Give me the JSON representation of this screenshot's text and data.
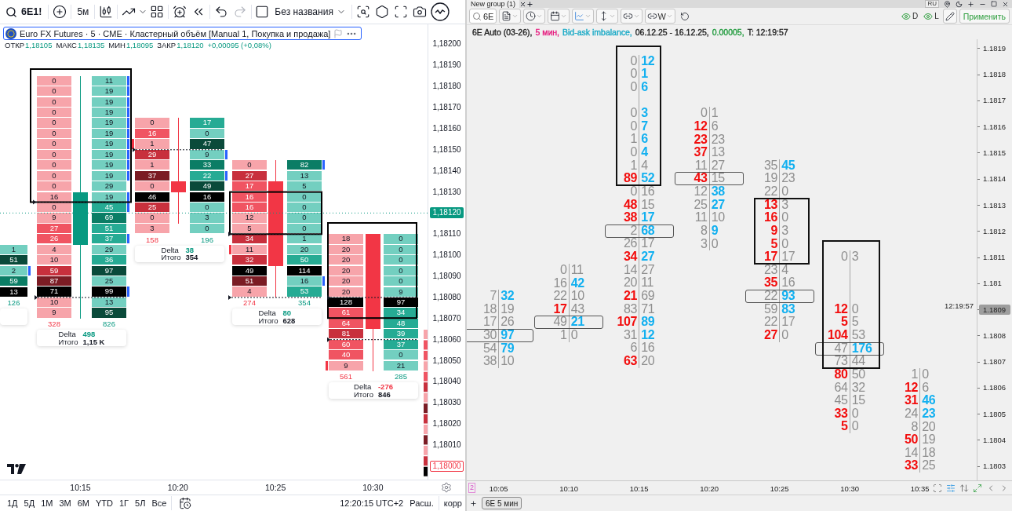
{
  "left_panel": {
    "toolbar": {
      "symbol": "6E1!",
      "interval": "5м",
      "layout_name": "Без названия"
    },
    "legend": {
      "title": "Euro FX Futures · 5 · CME · Кластерный объём [Manual 1, Покупка и продажа]",
      "ohlc": [
        {
          "label": "ОТКР",
          "value": "1,18105"
        },
        {
          "label": "МАКС",
          "value": "1,18135"
        },
        {
          "label": "МИН",
          "value": "1,18095"
        },
        {
          "label": "ЗАКР",
          "value": "1,18120"
        }
      ],
      "change": "+0,00095 (+0,08%)"
    },
    "clusters": [
      {
        "rows": [
          {
            "ask": {
              "value": "1",
              "color": "#73cfc0",
              "imbalance": false
            }
          },
          {
            "ask": {
              "value": "51",
              "color": "#0a4a3a",
              "imbalance": false
            }
          },
          {
            "ask": {
              "value": "2",
              "color": "#73cfc0",
              "imbalance": true
            }
          },
          {
            "ask": {
              "value": "59",
              "color": "#0b7d65",
              "imbalance": false
            }
          },
          {
            "ask": {
              "value": "13",
              "color": "#000000",
              "imbalance": false
            }
          }
        ],
        "ask_total": "126"
      },
      {
        "candle_up": true,
        "rows": [
          {
            "bid": {
              "value": "0",
              "color": "#f7a4aa",
              "imbalance": false
            },
            "ask": {
              "value": "11",
              "color": "#73cfc0",
              "imbalance": true
            }
          },
          {
            "bid": {
              "value": "0",
              "color": "#f7a4aa",
              "imbalance": false
            },
            "ask": {
              "value": "19",
              "color": "#73cfc0",
              "imbalance": true
            }
          },
          {
            "bid": {
              "value": "0",
              "color": "#f7a4aa",
              "imbalance": false
            },
            "ask": {
              "value": "19",
              "color": "#73cfc0",
              "imbalance": true
            }
          },
          {
            "bid": {
              "value": "0",
              "color": "#f7a4aa",
              "imbalance": false
            },
            "ask": {
              "value": "19",
              "color": "#73cfc0",
              "imbalance": true
            }
          },
          {
            "bid": {
              "value": "0",
              "color": "#f7a4aa",
              "imbalance": false
            },
            "ask": {
              "value": "19",
              "color": "#73cfc0",
              "imbalance": true
            }
          },
          {
            "bid": {
              "value": "0",
              "color": "#f7a4aa",
              "imbalance": false
            },
            "ask": {
              "value": "19",
              "color": "#73cfc0",
              "imbalance": true
            }
          },
          {
            "bid": {
              "value": "0",
              "color": "#f7a4aa",
              "imbalance": false
            },
            "ask": {
              "value": "19",
              "color": "#73cfc0",
              "imbalance": true
            }
          },
          {
            "bid": {
              "value": "0",
              "color": "#f7a4aa",
              "imbalance": false
            },
            "ask": {
              "value": "19",
              "color": "#73cfc0",
              "imbalance": true
            }
          },
          {
            "bid": {
              "value": "0",
              "color": "#f7a4aa",
              "imbalance": false
            },
            "ask": {
              "value": "19",
              "color": "#73cfc0",
              "imbalance": true
            }
          },
          {
            "bid": {
              "value": "0",
              "color": "#f7a4aa",
              "imbalance": false
            },
            "ask": {
              "value": "19",
              "color": "#73cfc0",
              "imbalance": true
            }
          },
          {
            "bid": {
              "value": "0",
              "color": "#f7a4aa",
              "imbalance": false
            },
            "ask": {
              "value": "29",
              "color": "#73cfc0",
              "imbalance": false
            }
          },
          {
            "bid": {
              "value": "16",
              "color": "#f7a4aa",
              "imbalance": false
            },
            "ask": {
              "value": "19",
              "color": "#73cfc0",
              "imbalance": true
            }
          },
          {
            "bid": {
              "value": "0",
              "color": "#f7a4aa",
              "imbalance": false
            },
            "ask": {
              "value": "45",
              "color": "#26ab94",
              "imbalance": true
            }
          },
          {
            "bid": {
              "value": "9",
              "color": "#f7a4aa",
              "imbalance": false
            },
            "ask": {
              "value": "69",
              "color": "#0b7d65",
              "imbalance": false
            }
          },
          {
            "bid": {
              "value": "27",
              "color": "#f05462",
              "imbalance": false
            },
            "ask": {
              "value": "51",
              "color": "#26ab94",
              "imbalance": false
            }
          },
          {
            "bid": {
              "value": "26",
              "color": "#f05462",
              "imbalance": false
            },
            "ask": {
              "value": "37",
              "color": "#26ab94",
              "imbalance": true
            }
          },
          {
            "bid": {
              "value": "4",
              "color": "#f7a4aa",
              "imbalance": false
            },
            "ask": {
              "value": "29",
              "color": "#73cfc0",
              "imbalance": false
            }
          },
          {
            "bid": {
              "value": "10",
              "color": "#f7a4aa",
              "imbalance": false
            },
            "ask": {
              "value": "36",
              "color": "#26ab94",
              "imbalance": false
            }
          },
          {
            "bid": {
              "value": "59",
              "color": "#c8303d",
              "imbalance": false
            },
            "ask": {
              "value": "97",
              "color": "#0a4a3a",
              "imbalance": false
            }
          },
          {
            "bid": {
              "value": "87",
              "color": "#7b1c24",
              "imbalance": false
            },
            "ask": {
              "value": "25",
              "color": "#73cfc0",
              "imbalance": false
            }
          },
          {
            "bid": {
              "value": "71",
              "color": "#000000",
              "imbalance": false
            },
            "ask": {
              "value": "99",
              "color": "#000000",
              "imbalance": true
            }
          },
          {
            "bid": {
              "value": "10",
              "color": "#f7a4aa",
              "imbalance": false
            },
            "ask": {
              "value": "13",
              "color": "#73cfc0",
              "imbalance": false
            }
          },
          {
            "bid": {
              "value": "9",
              "color": "#f7a4aa",
              "imbalance": false
            },
            "ask": {
              "value": "95",
              "color": "#0a4a3a",
              "imbalance": false
            }
          }
        ],
        "bid_total": "328",
        "ask_total": "826",
        "delta_label": "Delta",
        "delta": "498",
        "delta_negative": false,
        "total_label": "Итого",
        "total": "1,15 K"
      },
      {
        "candle_up": false,
        "rows": [
          {
            "bid": {
              "value": "0",
              "color": "#f7a4aa",
              "imbalance": false
            },
            "ask": {
              "value": "17",
              "color": "#26ab94",
              "imbalance": false
            }
          },
          {
            "bid": {
              "value": "16",
              "color": "#f05462",
              "imbalance": false
            },
            "ask": {
              "value": "0",
              "color": "#73cfc0",
              "imbalance": false
            }
          },
          {
            "bid": {
              "value": "1",
              "color": "#f7a4aa",
              "imbalance": true
            },
            "ask": {
              "value": "47",
              "color": "#0a4a3a",
              "imbalance": false
            }
          },
          {
            "bid": {
              "value": "29",
              "color": "#c8303d",
              "imbalance": false
            },
            "ask": {
              "value": "9",
              "color": "#73cfc0",
              "imbalance": true
            }
          },
          {
            "bid": {
              "value": "1",
              "color": "#f7a4aa",
              "imbalance": false
            },
            "ask": {
              "value": "33",
              "color": "#0b7d65",
              "imbalance": false
            }
          },
          {
            "bid": {
              "value": "37",
              "color": "#7b1c24",
              "imbalance": false
            },
            "ask": {
              "value": "22",
              "color": "#26ab94",
              "imbalance": true
            }
          },
          {
            "bid": {
              "value": "0",
              "color": "#f7a4aa",
              "imbalance": false
            },
            "ask": {
              "value": "49",
              "color": "#0a4a3a",
              "imbalance": false
            }
          },
          {
            "bid": {
              "value": "46",
              "color": "#000000",
              "imbalance": false
            },
            "ask": {
              "value": "16",
              "color": "#000000",
              "imbalance": false
            }
          },
          {
            "bid": {
              "value": "25",
              "color": "#c8303d",
              "imbalance": false
            },
            "ask": {
              "value": "0",
              "color": "#73cfc0",
              "imbalance": false
            }
          },
          {
            "bid": {
              "value": "0",
              "color": "#f7a4aa",
              "imbalance": false
            },
            "ask": {
              "value": "3",
              "color": "#73cfc0",
              "imbalance": false
            }
          },
          {
            "bid": {
              "value": "3",
              "color": "#f7a4aa",
              "imbalance": false
            },
            "ask": {
              "value": "0",
              "color": "#73cfc0",
              "imbalance": false
            }
          }
        ],
        "bid_total": "158",
        "ask_total": "196",
        "delta_label": "Delta",
        "delta": "38",
        "delta_negative": false,
        "total_label": "Итого",
        "total": "354"
      },
      {
        "candle_up": false,
        "rows": [
          {
            "bid": {
              "value": "0",
              "color": "#f7a4aa",
              "imbalance": false
            },
            "ask": {
              "value": "82",
              "color": "#0b7d65",
              "imbalance": true
            }
          },
          {
            "bid": {
              "value": "27",
              "color": "#c8303d",
              "imbalance": false
            },
            "ask": {
              "value": "13",
              "color": "#73cfc0",
              "imbalance": false
            }
          },
          {
            "bid": {
              "value": "17",
              "color": "#f05462",
              "imbalance": false
            },
            "ask": {
              "value": "5",
              "color": "#73cfc0",
              "imbalance": false
            }
          },
          {
            "bid": {
              "value": "16",
              "color": "#f05462",
              "imbalance": false
            },
            "ask": {
              "value": "0",
              "color": "#73cfc0",
              "imbalance": false
            }
          },
          {
            "bid": {
              "value": "16",
              "color": "#f05462",
              "imbalance": false
            },
            "ask": {
              "value": "0",
              "color": "#73cfc0",
              "imbalance": false
            }
          },
          {
            "bid": {
              "value": "12",
              "color": "#f7a4aa",
              "imbalance": false
            },
            "ask": {
              "value": "0",
              "color": "#73cfc0",
              "imbalance": false
            }
          },
          {
            "bid": {
              "value": "5",
              "color": "#f7a4aa",
              "imbalance": false
            },
            "ask": {
              "value": "0",
              "color": "#73cfc0",
              "imbalance": false
            }
          },
          {
            "bid": {
              "value": "34",
              "color": "#c8303d",
              "imbalance": false
            },
            "ask": {
              "value": "1",
              "color": "#73cfc0",
              "imbalance": false
            }
          },
          {
            "bid": {
              "value": "11",
              "color": "#f7a4aa",
              "imbalance": true
            },
            "ask": {
              "value": "20",
              "color": "#73cfc0",
              "imbalance": false
            }
          },
          {
            "bid": {
              "value": "32",
              "color": "#c8303d",
              "imbalance": false
            },
            "ask": {
              "value": "50",
              "color": "#26ab94",
              "imbalance": false
            }
          },
          {
            "bid": {
              "value": "49",
              "color": "#000000",
              "imbalance": false
            },
            "ask": {
              "value": "114",
              "color": "#000000",
              "imbalance": false
            }
          },
          {
            "bid": {
              "value": "51",
              "color": "#7b1c24",
              "imbalance": false
            },
            "ask": {
              "value": "16",
              "color": "#73cfc0",
              "imbalance": true
            }
          },
          {
            "bid": {
              "value": "4",
              "color": "#f7a4aa",
              "imbalance": false
            },
            "ask": {
              "value": "53",
              "color": "#26ab94",
              "imbalance": false
            }
          }
        ],
        "bid_total": "274",
        "ask_total": "354",
        "delta_label": "Delta",
        "delta": "80",
        "delta_negative": false,
        "total_label": "Итого",
        "total": "628"
      },
      {
        "candle_up": false,
        "rows": [
          {
            "bid": {
              "value": "18",
              "color": "#f7a4aa",
              "imbalance": false
            },
            "ask": {
              "value": "0",
              "color": "#73cfc0",
              "imbalance": false
            }
          },
          {
            "bid": {
              "value": "20",
              "color": "#f7a4aa",
              "imbalance": false
            },
            "ask": {
              "value": "0",
              "color": "#73cfc0",
              "imbalance": false
            }
          },
          {
            "bid": {
              "value": "20",
              "color": "#f7a4aa",
              "imbalance": false
            },
            "ask": {
              "value": "0",
              "color": "#73cfc0",
              "imbalance": false
            }
          },
          {
            "bid": {
              "value": "20",
              "color": "#f7a4aa",
              "imbalance": false
            },
            "ask": {
              "value": "0",
              "color": "#73cfc0",
              "imbalance": false
            }
          },
          {
            "bid": {
              "value": "20",
              "color": "#f7a4aa",
              "imbalance": false
            },
            "ask": {
              "value": "0",
              "color": "#73cfc0",
              "imbalance": false
            }
          },
          {
            "bid": {
              "value": "20",
              "color": "#f7a4aa",
              "imbalance": false
            },
            "ask": {
              "value": "9",
              "color": "#73cfc0",
              "imbalance": false
            }
          },
          {
            "bid": {
              "value": "128",
              "color": "#000000",
              "imbalance": false
            },
            "ask": {
              "value": "97",
              "color": "#000000",
              "imbalance": false
            }
          },
          {
            "bid": {
              "value": "61",
              "color": "#f05462",
              "imbalance": false
            },
            "ask": {
              "value": "34",
              "color": "#26ab94",
              "imbalance": false
            }
          },
          {
            "bid": {
              "value": "64",
              "color": "#f05462",
              "imbalance": false
            },
            "ask": {
              "value": "48",
              "color": "#26ab94",
              "imbalance": false
            }
          },
          {
            "bid": {
              "value": "81",
              "color": "#c8303d",
              "imbalance": false
            },
            "ask": {
              "value": "39",
              "color": "#26ab94",
              "imbalance": false
            }
          },
          {
            "bid": {
              "value": "60",
              "color": "#f05462",
              "imbalance": false
            },
            "ask": {
              "value": "37",
              "color": "#26ab94",
              "imbalance": false
            }
          },
          {
            "bid": {
              "value": "40",
              "color": "#f05462",
              "imbalance": false
            },
            "ask": {
              "value": "0",
              "color": "#73cfc0",
              "imbalance": false
            }
          },
          {
            "bid": {
              "value": "9",
              "color": "#f7a4aa",
              "imbalance": true
            },
            "ask": {
              "value": "21",
              "color": "#73cfc0",
              "imbalance": false
            }
          }
        ],
        "bid_total": "561",
        "ask_total": "285",
        "delta_label": "Delta",
        "delta": "-276",
        "delta_negative": true,
        "total_label": "Итого",
        "total": "846"
      }
    ],
    "price_axis": [
      {
        "label": "1,18200",
        "kind": "plain"
      },
      {
        "label": "1,18190",
        "kind": "plain"
      },
      {
        "label": "1,18180",
        "kind": "plain"
      },
      {
        "label": "1,18170",
        "kind": "plain"
      },
      {
        "label": "1,18160",
        "kind": "plain"
      },
      {
        "label": "1,18150",
        "kind": "plain"
      },
      {
        "label": "1,18140",
        "kind": "plain"
      },
      {
        "label": "1,18130",
        "kind": "plain"
      },
      {
        "label": "1,18120",
        "kind": "current"
      },
      {
        "label": "1,18110",
        "kind": "plain"
      },
      {
        "label": "1,18100",
        "kind": "plain"
      },
      {
        "label": "1,18090",
        "kind": "plain"
      },
      {
        "label": "1,18080",
        "kind": "plain"
      },
      {
        "label": "1,18070",
        "kind": "plain"
      },
      {
        "label": "1,18060",
        "kind": "plain"
      },
      {
        "label": "1,18050",
        "kind": "plain"
      },
      {
        "label": "1,18040",
        "kind": "plain"
      },
      {
        "label": "1,18030",
        "kind": "plain"
      },
      {
        "label": "1,18020",
        "kind": "plain"
      },
      {
        "label": "1,18010",
        "kind": "plain"
      },
      {
        "label": "1,18000",
        "kind": "marked"
      }
    ],
    "time_axis": [
      "10:15",
      "10:20",
      "10:25",
      "10:30"
    ],
    "ranges": [
      "1Д",
      "5Д",
      "1М",
      "3М",
      "6М",
      "YTD",
      "1Г",
      "5Л",
      "Все"
    ],
    "clock": "12:20:15 UTC+2",
    "session": "Расш.",
    "adjust": "корр"
  },
  "right_panel": {
    "tab_title": "New group (1)",
    "language": "RU",
    "toolbar": {
      "symbol": "6E",
      "link_label": "W",
      "toggles": [
        {
          "label": "D",
          "on": true
        },
        {
          "label": "L",
          "on": true
        }
      ],
      "apply": "Применить"
    },
    "info": [
      {
        "text": "6E Auto (03-26),",
        "color": "#1e1e1e"
      },
      {
        "text": "5 мин,",
        "color": "#e6197d"
      },
      {
        "text": "Bid-ask imbalance,",
        "color": "#17a9c6"
      },
      {
        "text": "06.12.25 - 16.12.25,",
        "color": "#1e1e1e"
      },
      {
        "text": "0.00005,",
        "color": "#1f9a3c"
      },
      {
        "text": "T: 12:19:57",
        "color": "#1e1e1e"
      }
    ],
    "clusters": [
      {
        "rows": [
          {
            "kind": "cells",
            "bid": "7",
            "ask": "32",
            "bid_hot": false,
            "ask_hot": true,
            "poc": false
          },
          {
            "kind": "cells",
            "bid": "18",
            "ask": "19",
            "bid_hot": false,
            "ask_hot": false,
            "poc": false
          },
          {
            "kind": "cells",
            "bid": "17",
            "ask": "26",
            "bid_hot": false,
            "ask_hot": false,
            "poc": false
          },
          {
            "kind": "cells",
            "bid": "30",
            "ask": "97",
            "bid_hot": false,
            "ask_hot": true,
            "poc": true
          },
          {
            "kind": "cells",
            "bid": "54",
            "ask": "79",
            "bid_hot": false,
            "ask_hot": true,
            "poc": false
          },
          {
            "kind": "cells",
            "bid": "38",
            "ask": "10",
            "bid_hot": false,
            "ask_hot": false,
            "poc": false
          }
        ]
      },
      {
        "rows": [
          {
            "kind": "cells",
            "bid": "0",
            "ask": "11",
            "bid_hot": false,
            "ask_hot": false,
            "poc": false
          },
          {
            "kind": "cells",
            "bid": "16",
            "ask": "42",
            "bid_hot": false,
            "ask_hot": true,
            "poc": false
          },
          {
            "kind": "cells",
            "bid": "22",
            "ask": "10",
            "bid_hot": false,
            "ask_hot": false,
            "poc": false
          },
          {
            "kind": "cells",
            "bid": "17",
            "ask": "43",
            "bid_hot": true,
            "ask_hot": false,
            "poc": false
          },
          {
            "kind": "cells",
            "bid": "49",
            "ask": "21",
            "bid_hot": false,
            "ask_hot": true,
            "poc": true
          },
          {
            "kind": "cells",
            "bid": "1",
            "ask": "0",
            "bid_hot": false,
            "ask_hot": false,
            "poc": false
          }
        ]
      },
      {
        "rows": [
          {
            "kind": "cells",
            "bid": "0",
            "ask": "12",
            "bid_hot": false,
            "ask_hot": true,
            "poc": false
          },
          {
            "kind": "cells",
            "bid": "0",
            "ask": "1",
            "bid_hot": false,
            "ask_hot": true,
            "poc": false
          },
          {
            "kind": "cells",
            "bid": "0",
            "ask": "6",
            "bid_hot": false,
            "ask_hot": true,
            "poc": false
          },
          {
            "kind": "gap"
          },
          {
            "kind": "cells",
            "bid": "0",
            "ask": "3",
            "bid_hot": false,
            "ask_hot": true,
            "poc": false
          },
          {
            "kind": "cells",
            "bid": "0",
            "ask": "7",
            "bid_hot": false,
            "ask_hot": true,
            "poc": false
          },
          {
            "kind": "cells",
            "bid": "1",
            "ask": "6",
            "bid_hot": false,
            "ask_hot": true,
            "poc": false
          },
          {
            "kind": "cells",
            "bid": "0",
            "ask": "4",
            "bid_hot": false,
            "ask_hot": true,
            "poc": false
          },
          {
            "kind": "cells",
            "bid": "1",
            "ask": "4",
            "bid_hot": false,
            "ask_hot": false,
            "poc": false
          },
          {
            "kind": "cells",
            "bid": "89",
            "ask": "52",
            "bid_hot": true,
            "ask_hot": true,
            "poc": false
          },
          {
            "kind": "cells",
            "bid": "0",
            "ask": "16",
            "bid_hot": false,
            "ask_hot": false,
            "poc": false
          },
          {
            "kind": "cells",
            "bid": "48",
            "ask": "15",
            "bid_hot": true,
            "ask_hot": false,
            "poc": false
          },
          {
            "kind": "cells",
            "bid": "38",
            "ask": "17",
            "bid_hot": true,
            "ask_hot": true,
            "poc": false
          },
          {
            "kind": "cells",
            "bid": "2",
            "ask": "68",
            "bid_hot": false,
            "ask_hot": true,
            "poc": true
          },
          {
            "kind": "cells",
            "bid": "26",
            "ask": "17",
            "bid_hot": false,
            "ask_hot": false,
            "poc": false
          },
          {
            "kind": "cells",
            "bid": "34",
            "ask": "27",
            "bid_hot": true,
            "ask_hot": true,
            "poc": false
          },
          {
            "kind": "cells",
            "bid": "14",
            "ask": "27",
            "bid_hot": false,
            "ask_hot": false,
            "poc": false
          },
          {
            "kind": "cells",
            "bid": "20",
            "ask": "11",
            "bid_hot": false,
            "ask_hot": false,
            "poc": false
          },
          {
            "kind": "cells",
            "bid": "21",
            "ask": "69",
            "bid_hot": true,
            "ask_hot": false,
            "poc": false
          },
          {
            "kind": "cells",
            "bid": "83",
            "ask": "71",
            "bid_hot": false,
            "ask_hot": false,
            "poc": false
          },
          {
            "kind": "cells",
            "bid": "107",
            "ask": "89",
            "bid_hot": true,
            "ask_hot": true,
            "poc": false
          },
          {
            "kind": "cells",
            "bid": "31",
            "ask": "12",
            "bid_hot": false,
            "ask_hot": true,
            "poc": false
          },
          {
            "kind": "cells",
            "bid": "6",
            "ask": "16",
            "bid_hot": false,
            "ask_hot": false,
            "poc": false
          },
          {
            "kind": "cells",
            "bid": "63",
            "ask": "20",
            "bid_hot": true,
            "ask_hot": false,
            "poc": false
          }
        ]
      },
      {
        "rows": [
          {
            "kind": "cells",
            "bid": "0",
            "ask": "1",
            "bid_hot": false,
            "ask_hot": false,
            "poc": false
          },
          {
            "kind": "cells",
            "bid": "12",
            "ask": "6",
            "bid_hot": true,
            "ask_hot": false,
            "poc": false
          },
          {
            "kind": "cells",
            "bid": "23",
            "ask": "23",
            "bid_hot": true,
            "ask_hot": false,
            "poc": false
          },
          {
            "kind": "cells",
            "bid": "37",
            "ask": "13",
            "bid_hot": true,
            "ask_hot": false,
            "poc": false
          },
          {
            "kind": "cells",
            "bid": "11",
            "ask": "27",
            "bid_hot": false,
            "ask_hot": false,
            "poc": false
          },
          {
            "kind": "cells",
            "bid": "43",
            "ask": "15",
            "bid_hot": true,
            "ask_hot": false,
            "poc": true
          },
          {
            "kind": "cells",
            "bid": "12",
            "ask": "38",
            "bid_hot": false,
            "ask_hot": true,
            "poc": false
          },
          {
            "kind": "cells",
            "bid": "25",
            "ask": "27",
            "bid_hot": false,
            "ask_hot": true,
            "poc": false
          },
          {
            "kind": "cells",
            "bid": "11",
            "ask": "10",
            "bid_hot": false,
            "ask_hot": false,
            "poc": false
          },
          {
            "kind": "cells",
            "bid": "8",
            "ask": "9",
            "bid_hot": false,
            "ask_hot": true,
            "poc": false
          },
          {
            "kind": "cells",
            "bid": "3",
            "ask": "0",
            "bid_hot": false,
            "ask_hot": false,
            "poc": false
          }
        ]
      },
      {
        "rows": [
          {
            "kind": "cells",
            "bid": "35",
            "ask": "45",
            "bid_hot": false,
            "ask_hot": true,
            "poc": false
          },
          {
            "kind": "cells",
            "bid": "19",
            "ask": "23",
            "bid_hot": false,
            "ask_hot": false,
            "poc": false
          },
          {
            "kind": "cells",
            "bid": "22",
            "ask": "0",
            "bid_hot": false,
            "ask_hot": false,
            "poc": false
          },
          {
            "kind": "cells",
            "bid": "13",
            "ask": "3",
            "bid_hot": true,
            "ask_hot": false,
            "poc": false
          },
          {
            "kind": "cells",
            "bid": "16",
            "ask": "0",
            "bid_hot": true,
            "ask_hot": false,
            "poc": false
          },
          {
            "kind": "cells",
            "bid": "9",
            "ask": "3",
            "bid_hot": true,
            "ask_hot": false,
            "poc": false
          },
          {
            "kind": "cells",
            "bid": "5",
            "ask": "0",
            "bid_hot": true,
            "ask_hot": false,
            "poc": false
          },
          {
            "kind": "cells",
            "bid": "17",
            "ask": "17",
            "bid_hot": true,
            "ask_hot": false,
            "poc": false
          },
          {
            "kind": "cells",
            "bid": "23",
            "ask": "4",
            "bid_hot": false,
            "ask_hot": false,
            "poc": false
          },
          {
            "kind": "cells",
            "bid": "35",
            "ask": "16",
            "bid_hot": true,
            "ask_hot": false,
            "poc": false
          },
          {
            "kind": "cells",
            "bid": "22",
            "ask": "93",
            "bid_hot": false,
            "ask_hot": true,
            "poc": true
          },
          {
            "kind": "cells",
            "bid": "59",
            "ask": "83",
            "bid_hot": false,
            "ask_hot": true,
            "poc": false
          },
          {
            "kind": "cells",
            "bid": "22",
            "ask": "17",
            "bid_hot": false,
            "ask_hot": false,
            "poc": false
          },
          {
            "kind": "cells",
            "bid": "27",
            "ask": "0",
            "bid_hot": true,
            "ask_hot": false,
            "poc": false
          }
        ]
      },
      {
        "rows": [
          {
            "kind": "cells",
            "bid": "0",
            "ask": "3",
            "bid_hot": false,
            "ask_hot": false,
            "poc": false
          },
          {
            "kind": "gap"
          },
          {
            "kind": "gap"
          },
          {
            "kind": "gap"
          },
          {
            "kind": "cells",
            "bid": "12",
            "ask": "0",
            "bid_hot": true,
            "ask_hot": false,
            "poc": false
          },
          {
            "kind": "cells",
            "bid": "5",
            "ask": "5",
            "bid_hot": true,
            "ask_hot": false,
            "poc": false
          },
          {
            "kind": "cells",
            "bid": "104",
            "ask": "53",
            "bid_hot": true,
            "ask_hot": false,
            "poc": false
          },
          {
            "kind": "cells",
            "bid": "47",
            "ask": "176",
            "bid_hot": false,
            "ask_hot": true,
            "poc": true
          },
          {
            "kind": "cells",
            "bid": "73",
            "ask": "44",
            "bid_hot": false,
            "ask_hot": false,
            "poc": false
          },
          {
            "kind": "cells",
            "bid": "80",
            "ask": "50",
            "bid_hot": true,
            "ask_hot": false,
            "poc": false
          },
          {
            "kind": "cells",
            "bid": "64",
            "ask": "32",
            "bid_hot": false,
            "ask_hot": false,
            "poc": false
          },
          {
            "kind": "cells",
            "bid": "45",
            "ask": "15",
            "bid_hot": false,
            "ask_hot": false,
            "poc": false
          },
          {
            "kind": "cells",
            "bid": "33",
            "ask": "0",
            "bid_hot": true,
            "ask_hot": false,
            "poc": false
          },
          {
            "kind": "cells",
            "bid": "5",
            "ask": "0",
            "bid_hot": true,
            "ask_hot": false,
            "poc": false
          }
        ]
      },
      {
        "rows": [
          {
            "kind": "cells",
            "bid": "1",
            "ask": "0",
            "bid_hot": false,
            "ask_hot": false,
            "poc": false
          },
          {
            "kind": "cells",
            "bid": "12",
            "ask": "6",
            "bid_hot": true,
            "ask_hot": false,
            "poc": false
          },
          {
            "kind": "cells",
            "bid": "31",
            "ask": "46",
            "bid_hot": true,
            "ask_hot": true,
            "poc": false
          },
          {
            "kind": "cells",
            "bid": "24",
            "ask": "23",
            "bid_hot": false,
            "ask_hot": true,
            "poc": false
          },
          {
            "kind": "cells",
            "bid": "8",
            "ask": "20",
            "bid_hot": false,
            "ask_hot": false,
            "poc": false
          },
          {
            "kind": "cells",
            "bid": "50",
            "ask": "19",
            "bid_hot": true,
            "ask_hot": false,
            "poc": false
          },
          {
            "kind": "cells",
            "bid": "14",
            "ask": "18",
            "bid_hot": false,
            "ask_hot": false,
            "poc": false
          },
          {
            "kind": "cells",
            "bid": "33",
            "ask": "25",
            "bid_hot": true,
            "ask_hot": false,
            "poc": false
          }
        ]
      }
    ],
    "price_axis": [
      {
        "label": "1.1819",
        "kind": "plain"
      },
      {
        "label": "1.1818",
        "kind": "plain"
      },
      {
        "label": "1.1817",
        "kind": "plain"
      },
      {
        "label": "1.1816",
        "kind": "plain"
      },
      {
        "label": "1.1815",
        "kind": "plain"
      },
      {
        "label": "1.1814",
        "kind": "plain"
      },
      {
        "label": "1.1813",
        "kind": "plain"
      },
      {
        "label": "1.1812",
        "kind": "plain"
      },
      {
        "label": "1.1811",
        "kind": "plain"
      },
      {
        "label": "1.181",
        "kind": "plain"
      },
      {
        "label": "1.1809",
        "kind": "current"
      },
      {
        "label": "1.1808",
        "kind": "plain"
      },
      {
        "label": "1.1807",
        "kind": "plain"
      },
      {
        "label": "1.1806",
        "kind": "plain"
      },
      {
        "label": "1.1805",
        "kind": "plain"
      },
      {
        "label": "1.1804",
        "kind": "plain"
      },
      {
        "label": "1.1803",
        "kind": "plain"
      }
    ],
    "last_time": "12:19:57",
    "time_axis": [
      "10:05",
      "10:10",
      "10:15",
      "10:20",
      "10:25",
      "10:30",
      "10:35"
    ],
    "pane_number": "2",
    "chart_tab": "6E 5 мин"
  }
}
